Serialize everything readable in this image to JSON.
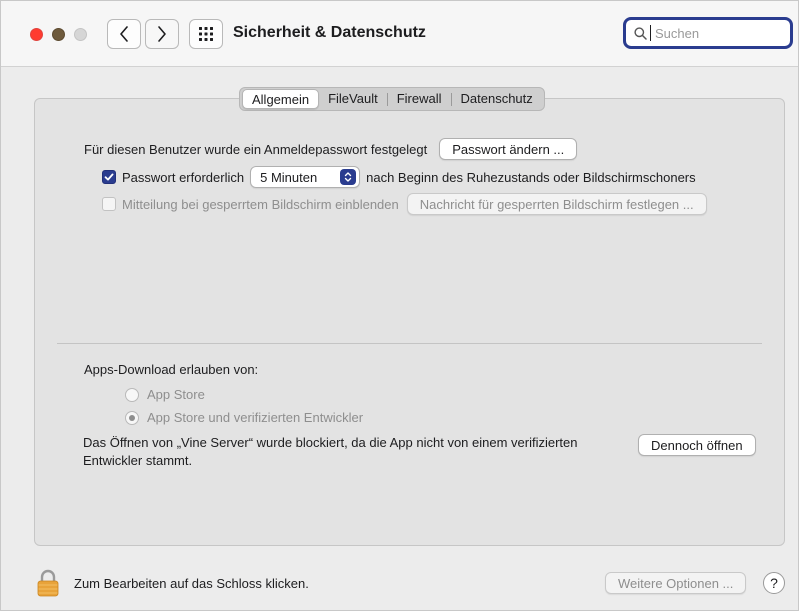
{
  "window": {
    "title": "Sicherheit & Datenschutz"
  },
  "search": {
    "placeholder": "Suchen",
    "value": ""
  },
  "tabs": [
    {
      "label": "Allgemein",
      "active": true
    },
    {
      "label": "FileVault",
      "active": false
    },
    {
      "label": "Firewall",
      "active": false
    },
    {
      "label": "Datenschutz",
      "active": false
    }
  ],
  "general": {
    "password_set_text": "Für diesen Benutzer wurde ein Anmeldepasswort festgelegt",
    "change_password_button": "Passwort ändern ...",
    "require_password": {
      "checked": true,
      "label": "Passwort erforderlich",
      "delay_value": "5 Minuten",
      "suffix": "nach Beginn des Ruhezustands oder Bildschirmschoners"
    },
    "lock_message": {
      "checked": false,
      "label": "Mitteilung bei gesperrtem Bildschirm einblenden",
      "button": "Nachricht für gesperrten Bildschirm festlegen ..."
    }
  },
  "downloads": {
    "heading": "Apps-Download erlauben von:",
    "options": [
      {
        "label": "App Store",
        "selected": false
      },
      {
        "label": "App Store und verifizierten Entwickler",
        "selected": true
      }
    ],
    "blocked_message": "Das Öffnen von „Vine Server“ wurde blockiert, da die App nicht von einem verifizierten Entwickler stammt.",
    "open_anyway_button": "Dennoch öffnen"
  },
  "footer": {
    "lock_text": "Zum Bearbeiten auf das Schloss klicken.",
    "advanced_button": "Weitere Optionen ...",
    "help_label": "?"
  },
  "colors": {
    "accent": "#2a3c8f",
    "close": "#ff3b30",
    "minimize": "#6e5a3c",
    "zoom": "#d6d6d6",
    "lock": "#e8a33a"
  }
}
